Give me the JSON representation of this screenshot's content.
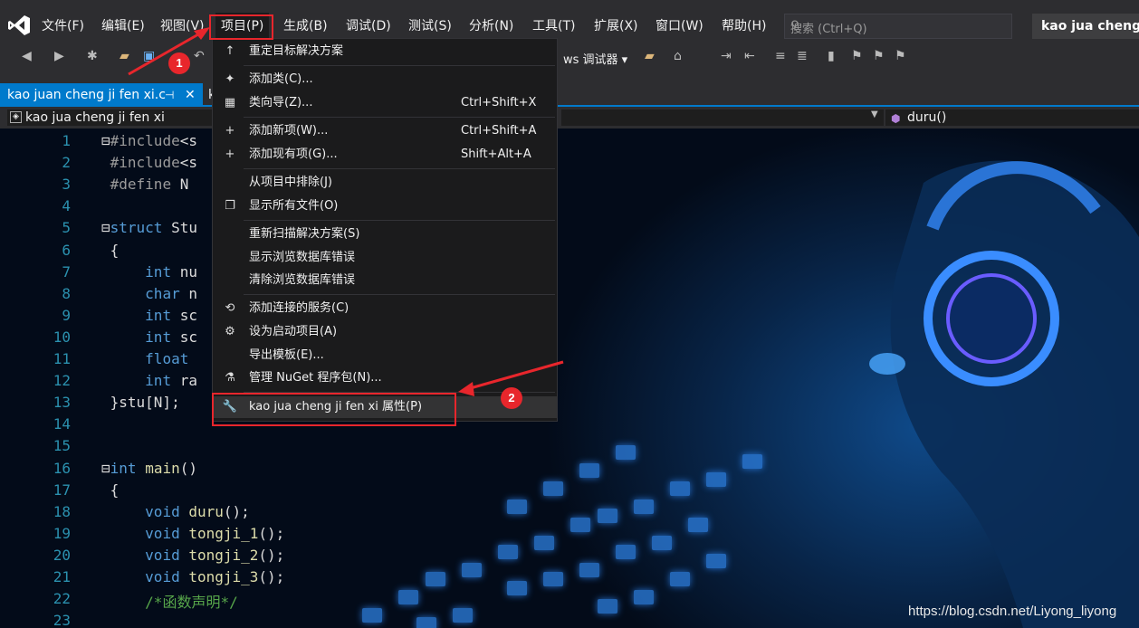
{
  "menubar": {
    "items": [
      "文件(F)",
      "编辑(E)",
      "视图(V)",
      "项目(P)",
      "生成(B)",
      "调试(D)",
      "测试(S)",
      "分析(N)",
      "工具(T)",
      "扩展(X)",
      "窗口(W)",
      "帮助(H)"
    ],
    "search_placeholder": "搜索 (Ctrl+Q)",
    "solution_title": "kao jua cheng ji fen xi"
  },
  "toolbar": {
    "debugger_label": "ws 调试器 ▾"
  },
  "tabs": {
    "active": "kao juan cheng ji fen xi.c",
    "second": "k"
  },
  "navbar": {
    "project": "kao jua cheng ji fen xi",
    "function": "duru()"
  },
  "editor": {
    "line_numbers": [
      "1",
      "2",
      "3",
      "4",
      "5",
      "6",
      "7",
      "8",
      "9",
      "10",
      "11",
      "12",
      "13",
      "14",
      "15",
      "16",
      "17",
      "18",
      "19",
      "20",
      "21",
      "22",
      "23"
    ],
    "lines": [
      "⊟#include<s",
      " #include<s",
      " #define N",
      "",
      "⊟struct Stu",
      " {",
      "     int nu",
      "     char n",
      "     int sc",
      "     int sc",
      "     float ",
      "     int ra",
      " }stu[N];",
      "",
      "",
      "⊟int main()",
      " {",
      "     void duru();",
      "     void tongji_1();",
      "     void tongji_2();",
      "     void tongji_3();",
      "     /*函数声明*/"
    ]
  },
  "dropdown": {
    "items": [
      {
        "icon": "↑",
        "label": "重定目标解决方案",
        "shortcut": ""
      },
      {
        "icon": "✦",
        "label": "添加类(C)...",
        "shortcut": ""
      },
      {
        "icon": "▦",
        "label": "类向导(Z)...",
        "shortcut": "Ctrl+Shift+X"
      },
      {
        "icon": "+",
        "label": "添加新项(W)...",
        "shortcut": "Ctrl+Shift+A"
      },
      {
        "icon": "+",
        "label": "添加现有项(G)...",
        "shortcut": "Shift+Alt+A"
      },
      {
        "icon": "",
        "label": "从项目中排除(J)",
        "shortcut": ""
      },
      {
        "icon": "❐",
        "label": "显示所有文件(O)",
        "shortcut": ""
      },
      {
        "icon": "",
        "label": "重新扫描解决方案(S)",
        "shortcut": ""
      },
      {
        "icon": "",
        "label": "显示浏览数据库错误",
        "shortcut": ""
      },
      {
        "icon": "",
        "label": "清除浏览数据库错误",
        "shortcut": ""
      },
      {
        "icon": "⟲",
        "label": "添加连接的服务(C)",
        "shortcut": ""
      },
      {
        "icon": "⚙",
        "label": "设为启动项目(A)",
        "shortcut": ""
      },
      {
        "icon": "",
        "label": "导出模板(E)...",
        "shortcut": ""
      },
      {
        "icon": "⚗",
        "label": "管理 NuGet 程序包(N)...",
        "shortcut": ""
      },
      {
        "icon": "🔧",
        "label": "kao jua cheng ji fen xi 属性(P)",
        "shortcut": ""
      }
    ]
  },
  "annotations": {
    "badge_1": "1",
    "badge_2": "2"
  },
  "watermark": "https://blog.csdn.net/Liyong_liyong",
  "colors": {
    "accent": "#007acc",
    "annotation": "#e8262c",
    "menubar": "#2d2d30"
  }
}
